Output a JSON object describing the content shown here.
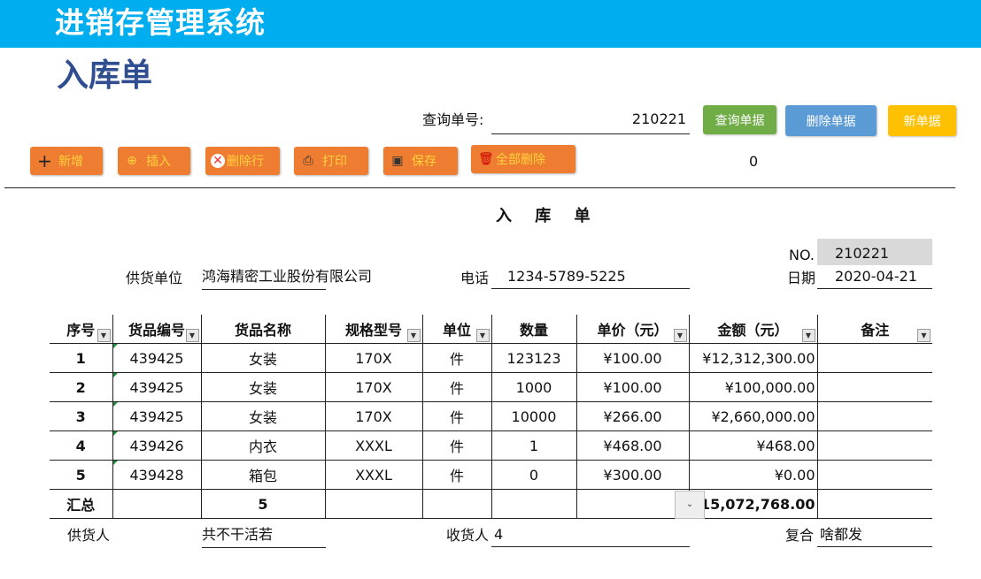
{
  "app": {
    "title": "进销存管理系统",
    "heading": "入库单"
  },
  "query": {
    "label": "查询单号:",
    "value": "210221"
  },
  "actions": {
    "query_label": "查询单据",
    "delete_label": "删除单据",
    "new_label": "新单据"
  },
  "toolbar": {
    "add_label": "新增",
    "insert_label": "插入",
    "delete_row_label": "删除行",
    "print_label": "打印",
    "save_label": "保存",
    "delete_all_label": "全部删除",
    "counter": "0"
  },
  "doc": {
    "title": "入 库 单",
    "no_label": "NO.",
    "no_value": "210221",
    "supplier_label": "供货单位",
    "supplier_value": "鸿海精密工业股份有限公司",
    "phone_label": "电话",
    "phone_value": "1234-5789-5225",
    "date_label": "日期",
    "date_value": "2020-04-21"
  },
  "table": {
    "headers": [
      "序号",
      "货品编号",
      "货品名称",
      "规格型号",
      "单位",
      "数量",
      "单价（元）",
      "金额（元）",
      "备注"
    ],
    "rows": [
      [
        "1",
        "439425",
        "女装",
        "170X",
        "件",
        "123123",
        "¥100.00",
        "¥12,312,300.00",
        ""
      ],
      [
        "2",
        "439425",
        "女装",
        "170X",
        "件",
        "1000",
        "¥100.00",
        "¥100,000.00",
        ""
      ],
      [
        "3",
        "439425",
        "女装",
        "170X",
        "件",
        "10000",
        "¥266.00",
        "¥2,660,000.00",
        ""
      ],
      [
        "4",
        "439426",
        "内衣",
        "XXXL",
        "件",
        "1",
        "¥468.00",
        "¥468.00",
        ""
      ],
      [
        "5",
        "439428",
        "箱包",
        "XXXL",
        "件",
        "0",
        "¥300.00",
        "¥0.00",
        ""
      ]
    ],
    "total_label": "汇总",
    "total_count": "5",
    "total_amount": "¥15,072,768.00"
  },
  "footer": {
    "supplier_person_label": "供货人",
    "supplier_person_value": "共不干活若",
    "receiver_label": "收货人",
    "receiver_value": "4",
    "reviewer_label": "复合",
    "reviewer_value": "啥都发"
  },
  "colors": {
    "topbar": "#00aeef",
    "heading": "#2f4d8f",
    "orange": "#ef7d31",
    "green": "#70ad47",
    "blue": "#5b9bd5",
    "yellow": "#ffc000"
  },
  "icons": [
    "plus-icon",
    "insert-icon",
    "delete-row-icon",
    "print-icon",
    "save-icon",
    "trash-icon",
    "dropdown-arrow-icon"
  ]
}
